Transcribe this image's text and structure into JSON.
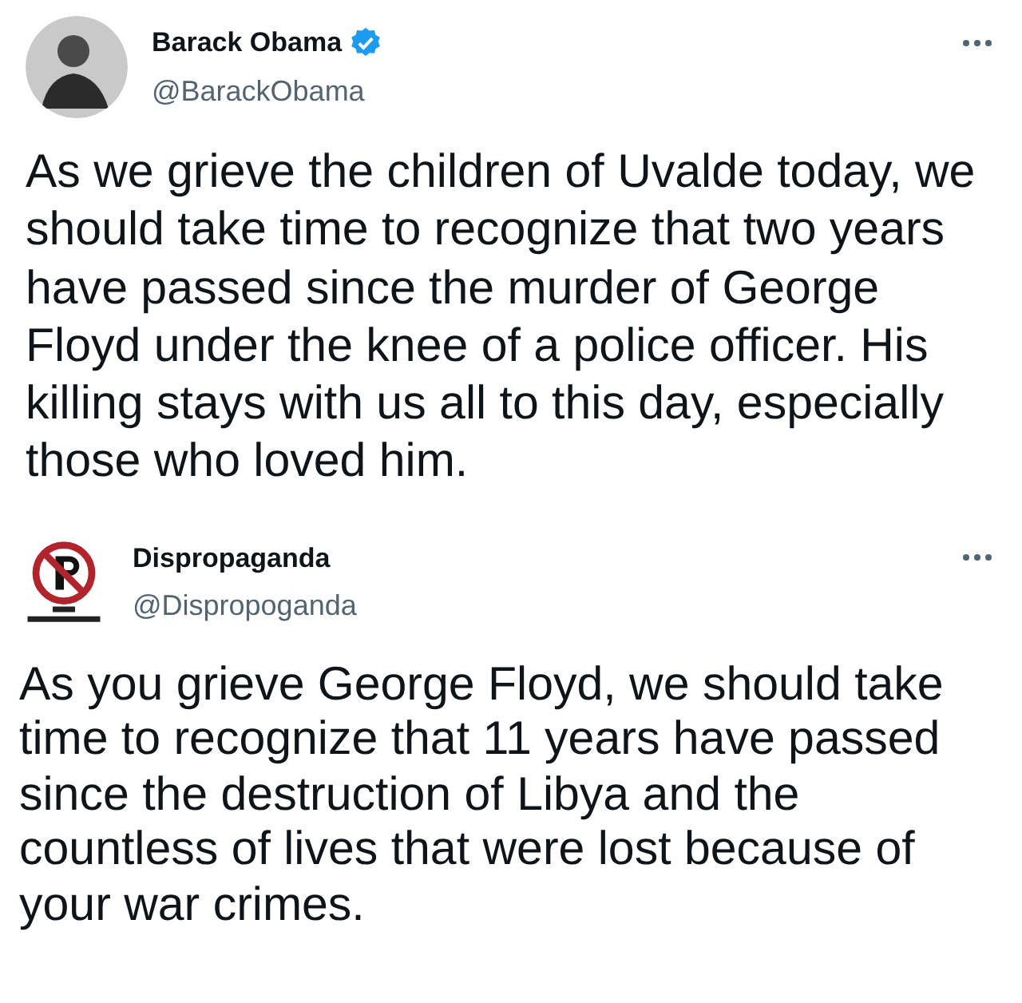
{
  "tweets": [
    {
      "name": "Barack Obama",
      "verified": true,
      "handle": "@BarackObama",
      "text": "As we grieve the children of Uvalde today, we should take time to recognize that two years have passed since the murder of George Floyd under the knee of a police officer. His killing stays with us all to this day, especially those who loved him."
    },
    {
      "name": "Dispropaganda",
      "verified": false,
      "handle": "@Dispropoganda",
      "text": "As you grieve George Floyd, we should take time to recognize that 11 years have passed since the destruction of Libya and the countless of lives that were lost because of your war crimes."
    }
  ]
}
